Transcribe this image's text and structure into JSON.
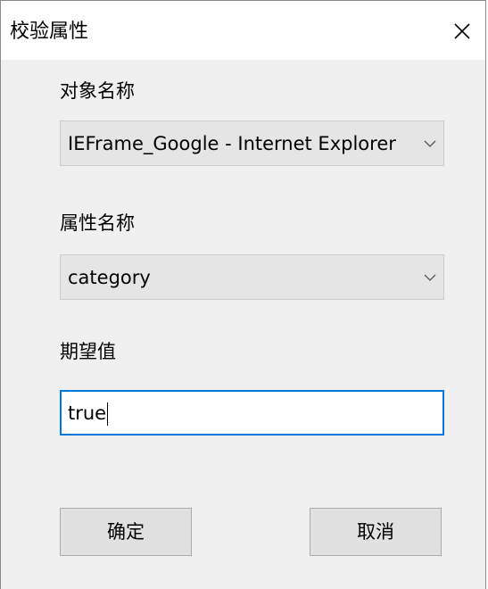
{
  "window": {
    "title": "校验属性",
    "close_icon": "close-icon"
  },
  "object_name": {
    "label": "对象名称",
    "selected": "IEFrame_Google - Internet Explorer"
  },
  "property_name": {
    "label": "属性名称",
    "selected": "category"
  },
  "expected_value": {
    "label": "期望值",
    "value": "true"
  },
  "buttons": {
    "ok_label": "确定",
    "cancel_label": "取消"
  },
  "colors": {
    "focus_border": "#0078d7",
    "dialog_background": "#f0f0f0",
    "button_background": "#e1e1e1"
  }
}
